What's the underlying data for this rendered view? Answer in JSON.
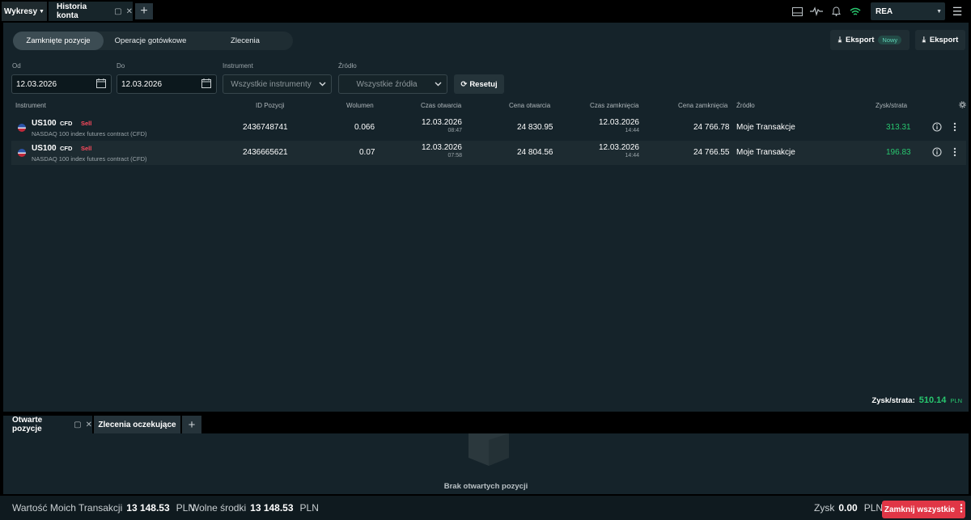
{
  "topbar": {
    "tab_charts": "Wykresy",
    "tab_history": "Historia konta",
    "account_label": "REA"
  },
  "segments": [
    "Zamknięte pozycje",
    "Operacje gotówkowe",
    "Zlecenia"
  ],
  "export": {
    "label": "Eksport",
    "new_badge": "Nowy"
  },
  "filters": {
    "from_label": "Od",
    "from_value": "12.03.2026",
    "to_label": "Do",
    "to_value": "12.03.2026",
    "instrument_label": "Instrument",
    "instrument_value": "Wszystkie instrumenty",
    "source_label": "Źródło",
    "source_value": "Wszystkie źródła",
    "reset_label": "Resetuj"
  },
  "table": {
    "headers": {
      "instrument": "Instrument",
      "position_id": "ID Pozycji",
      "volume": "Wolumen",
      "open_time": "Czas otwarcia",
      "open_price": "Cena otwarcia",
      "close_time": "Czas zamknięcia",
      "close_price": "Cena zamknięcia",
      "source": "Źródło",
      "pnl": "Zysk/strata"
    },
    "rows": [
      {
        "symbol": "US100",
        "type": "CFD",
        "side": "Sell",
        "description": "NASDAQ 100 index futures contract (CFD)",
        "position_id": "2436748741",
        "volume": "0.066",
        "open_date": "12.03.2026",
        "open_time": "08:47",
        "open_price": "24 830.95",
        "close_date": "12.03.2026",
        "close_time": "14:44",
        "close_price": "24 766.78",
        "source": "Moje Transakcje",
        "pnl": "313.31"
      },
      {
        "symbol": "US100",
        "type": "CFD",
        "side": "Sell",
        "description": "NASDAQ 100 index futures contract (CFD)",
        "position_id": "2436665621",
        "volume": "0.07",
        "open_date": "12.03.2026",
        "open_time": "07:58",
        "open_price": "24 804.56",
        "close_date": "12.03.2026",
        "close_time": "14:44",
        "close_price": "24 766.55",
        "source": "Moje Transakcje",
        "pnl": "196.83"
      }
    ]
  },
  "total": {
    "label": "Zysk/strata:",
    "value": "510.14",
    "currency": "PLN"
  },
  "bottom": {
    "tab_open": "Otwarte pozycje",
    "tab_pending": "Zlecenia oczekujące",
    "empty_text": "Brak otwartych pozycji"
  },
  "status": {
    "value_label": "Wartość Moich Transakcji",
    "value_amount": "13 148.53",
    "value_currency": "PLN",
    "free_label": "Wolne środki",
    "free_amount": "13 148.53",
    "free_currency": "PLN",
    "pnl_label": "Zysk",
    "pnl_amount": "0.00",
    "pnl_currency": "PLN",
    "close_all": "Zamknij wszystkie"
  },
  "colors": {
    "accent_green": "#28c76f",
    "sell_red": "#ff4a5d",
    "close_all_red": "#e03646"
  }
}
